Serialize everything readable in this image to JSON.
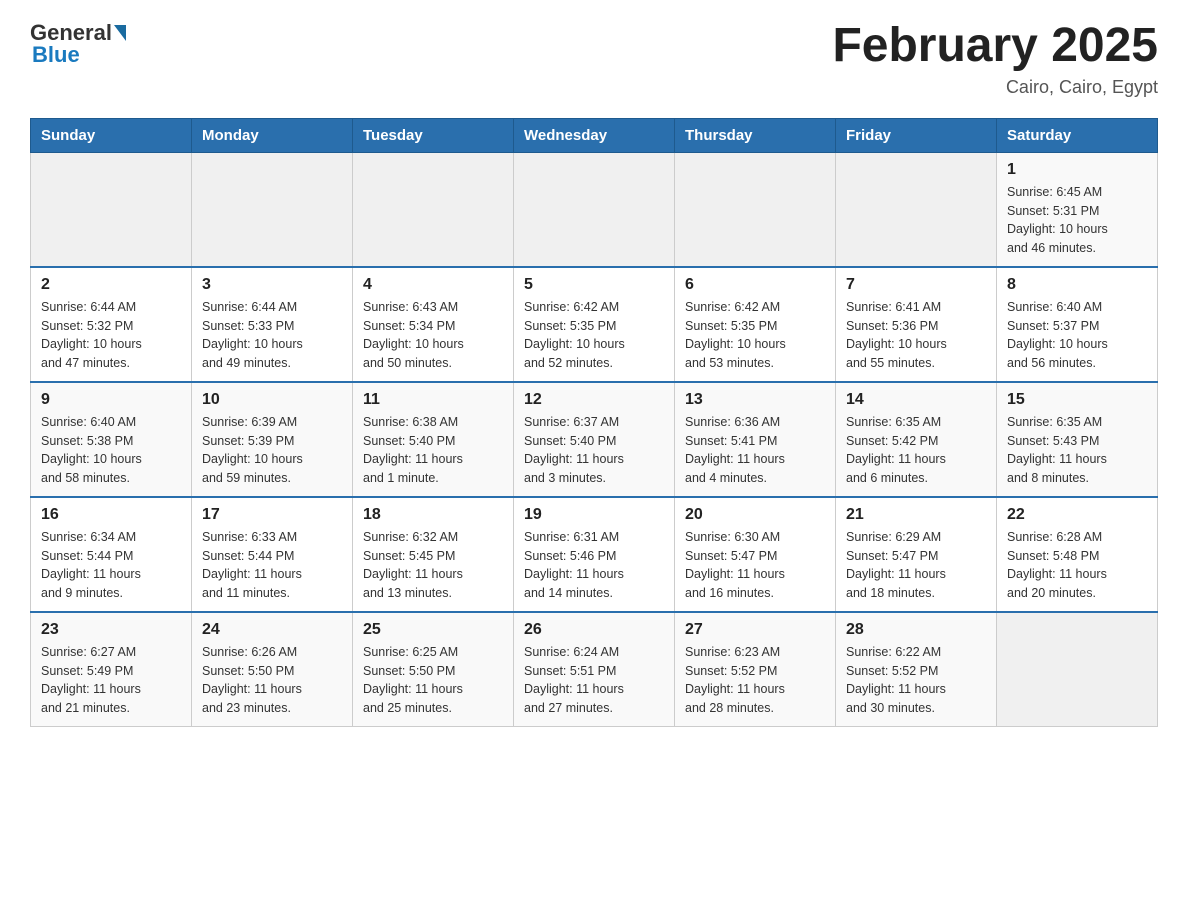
{
  "header": {
    "logo_text_general": "General",
    "logo_text_blue": "Blue",
    "title": "February 2025",
    "location": "Cairo, Cairo, Egypt"
  },
  "weekdays": [
    "Sunday",
    "Monday",
    "Tuesday",
    "Wednesday",
    "Thursday",
    "Friday",
    "Saturday"
  ],
  "weeks": [
    [
      {
        "day": "",
        "info": ""
      },
      {
        "day": "",
        "info": ""
      },
      {
        "day": "",
        "info": ""
      },
      {
        "day": "",
        "info": ""
      },
      {
        "day": "",
        "info": ""
      },
      {
        "day": "",
        "info": ""
      },
      {
        "day": "1",
        "info": "Sunrise: 6:45 AM\nSunset: 5:31 PM\nDaylight: 10 hours\nand 46 minutes."
      }
    ],
    [
      {
        "day": "2",
        "info": "Sunrise: 6:44 AM\nSunset: 5:32 PM\nDaylight: 10 hours\nand 47 minutes."
      },
      {
        "day": "3",
        "info": "Sunrise: 6:44 AM\nSunset: 5:33 PM\nDaylight: 10 hours\nand 49 minutes."
      },
      {
        "day": "4",
        "info": "Sunrise: 6:43 AM\nSunset: 5:34 PM\nDaylight: 10 hours\nand 50 minutes."
      },
      {
        "day": "5",
        "info": "Sunrise: 6:42 AM\nSunset: 5:35 PM\nDaylight: 10 hours\nand 52 minutes."
      },
      {
        "day": "6",
        "info": "Sunrise: 6:42 AM\nSunset: 5:35 PM\nDaylight: 10 hours\nand 53 minutes."
      },
      {
        "day": "7",
        "info": "Sunrise: 6:41 AM\nSunset: 5:36 PM\nDaylight: 10 hours\nand 55 minutes."
      },
      {
        "day": "8",
        "info": "Sunrise: 6:40 AM\nSunset: 5:37 PM\nDaylight: 10 hours\nand 56 minutes."
      }
    ],
    [
      {
        "day": "9",
        "info": "Sunrise: 6:40 AM\nSunset: 5:38 PM\nDaylight: 10 hours\nand 58 minutes."
      },
      {
        "day": "10",
        "info": "Sunrise: 6:39 AM\nSunset: 5:39 PM\nDaylight: 10 hours\nand 59 minutes."
      },
      {
        "day": "11",
        "info": "Sunrise: 6:38 AM\nSunset: 5:40 PM\nDaylight: 11 hours\nand 1 minute."
      },
      {
        "day": "12",
        "info": "Sunrise: 6:37 AM\nSunset: 5:40 PM\nDaylight: 11 hours\nand 3 minutes."
      },
      {
        "day": "13",
        "info": "Sunrise: 6:36 AM\nSunset: 5:41 PM\nDaylight: 11 hours\nand 4 minutes."
      },
      {
        "day": "14",
        "info": "Sunrise: 6:35 AM\nSunset: 5:42 PM\nDaylight: 11 hours\nand 6 minutes."
      },
      {
        "day": "15",
        "info": "Sunrise: 6:35 AM\nSunset: 5:43 PM\nDaylight: 11 hours\nand 8 minutes."
      }
    ],
    [
      {
        "day": "16",
        "info": "Sunrise: 6:34 AM\nSunset: 5:44 PM\nDaylight: 11 hours\nand 9 minutes."
      },
      {
        "day": "17",
        "info": "Sunrise: 6:33 AM\nSunset: 5:44 PM\nDaylight: 11 hours\nand 11 minutes."
      },
      {
        "day": "18",
        "info": "Sunrise: 6:32 AM\nSunset: 5:45 PM\nDaylight: 11 hours\nand 13 minutes."
      },
      {
        "day": "19",
        "info": "Sunrise: 6:31 AM\nSunset: 5:46 PM\nDaylight: 11 hours\nand 14 minutes."
      },
      {
        "day": "20",
        "info": "Sunrise: 6:30 AM\nSunset: 5:47 PM\nDaylight: 11 hours\nand 16 minutes."
      },
      {
        "day": "21",
        "info": "Sunrise: 6:29 AM\nSunset: 5:47 PM\nDaylight: 11 hours\nand 18 minutes."
      },
      {
        "day": "22",
        "info": "Sunrise: 6:28 AM\nSunset: 5:48 PM\nDaylight: 11 hours\nand 20 minutes."
      }
    ],
    [
      {
        "day": "23",
        "info": "Sunrise: 6:27 AM\nSunset: 5:49 PM\nDaylight: 11 hours\nand 21 minutes."
      },
      {
        "day": "24",
        "info": "Sunrise: 6:26 AM\nSunset: 5:50 PM\nDaylight: 11 hours\nand 23 minutes."
      },
      {
        "day": "25",
        "info": "Sunrise: 6:25 AM\nSunset: 5:50 PM\nDaylight: 11 hours\nand 25 minutes."
      },
      {
        "day": "26",
        "info": "Sunrise: 6:24 AM\nSunset: 5:51 PM\nDaylight: 11 hours\nand 27 minutes."
      },
      {
        "day": "27",
        "info": "Sunrise: 6:23 AM\nSunset: 5:52 PM\nDaylight: 11 hours\nand 28 minutes."
      },
      {
        "day": "28",
        "info": "Sunrise: 6:22 AM\nSunset: 5:52 PM\nDaylight: 11 hours\nand 30 minutes."
      },
      {
        "day": "",
        "info": ""
      }
    ]
  ]
}
